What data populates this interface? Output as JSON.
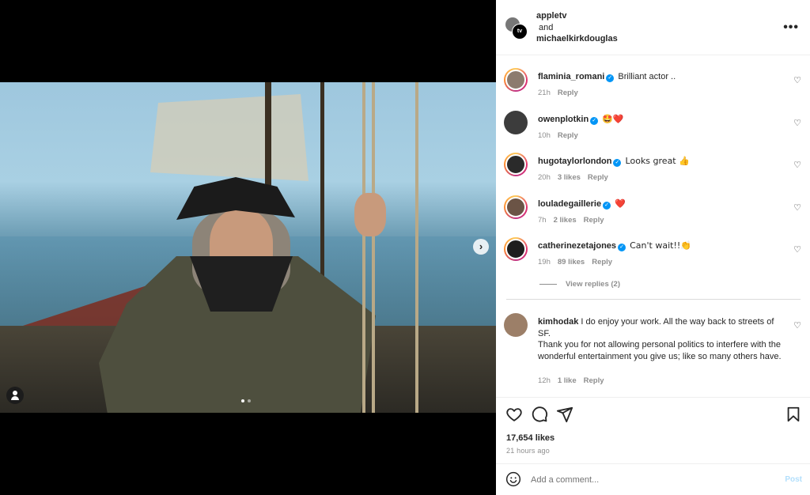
{
  "post": {
    "collaborators": [
      "appletv",
      "michaelkirkdouglas"
    ],
    "and_word": "and",
    "avatar_badge": "tv",
    "more": "•••",
    "likes": "17,654 likes",
    "time_ago": "21 hours ago",
    "carousel": {
      "slides": 2,
      "active": 0
    }
  },
  "comments": [
    {
      "username": "flaminia_romani",
      "verified": true,
      "text": "Brilliant actor ..",
      "time": "21h",
      "likes": "",
      "reply": "Reply",
      "story_ring": true
    },
    {
      "username": "owenplotkin",
      "verified": true,
      "text": "🤩❤️",
      "time": "10h",
      "likes": "",
      "reply": "Reply",
      "story_ring": false
    },
    {
      "username": "hugotaylorlondon",
      "verified": true,
      "text": "Looks great 👍",
      "time": "20h",
      "likes": "3 likes",
      "reply": "Reply",
      "story_ring": true
    },
    {
      "username": "louladegaillerie",
      "verified": true,
      "text": "❤️",
      "time": "7h",
      "likes": "2 likes",
      "reply": "Reply",
      "story_ring": true
    },
    {
      "username": "catherinezetajones",
      "verified": true,
      "text": "Can't wait!!👏",
      "time": "19h",
      "likes": "89 likes",
      "reply": "Reply",
      "story_ring": true
    },
    {
      "username": "kimhodak",
      "verified": false,
      "text": "I do enjoy your work. All the way back to streets of SF.",
      "text2": "Thank you for not allowing personal politics to interfere with the wonderful entertainment you give us; like so many others have.",
      "time": "12h",
      "likes": "1 like",
      "reply": "Reply",
      "story_ring": false
    }
  ],
  "view_replies": "View replies (2)",
  "add_comment": {
    "placeholder": "Add a comment...",
    "post_label": "Post"
  },
  "icons": {
    "next": "›",
    "comment_heart": "♡"
  },
  "colors": {
    "verified": "#0095f6",
    "post_disabled": "#b2dffc",
    "muted": "#8e8e8e"
  }
}
